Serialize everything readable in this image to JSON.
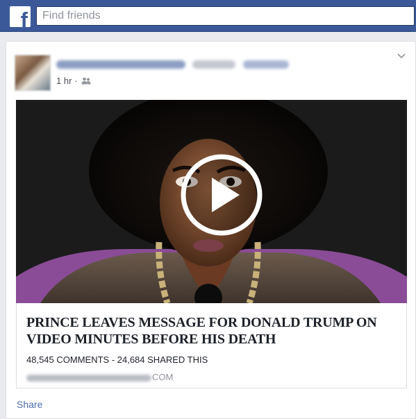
{
  "topbar": {
    "logo_letter": "f",
    "search_placeholder": "Find friends",
    "brand_color": "#3b5998"
  },
  "post": {
    "time": "1 hr",
    "separator": "·",
    "audience_icon": "friends-icon",
    "video": {
      "play_icon": "play-icon"
    },
    "link": {
      "headline": "PRINCE LEAVES MESSAGE FOR DONALD TRUMP ON VIDEO MINUTES BEFORE HIS DEATH",
      "stats": "48,545 COMMENTS - 24,684 SHARED THIS",
      "domain_suffix": "COM"
    },
    "actions": {
      "share_label": "Share"
    }
  }
}
